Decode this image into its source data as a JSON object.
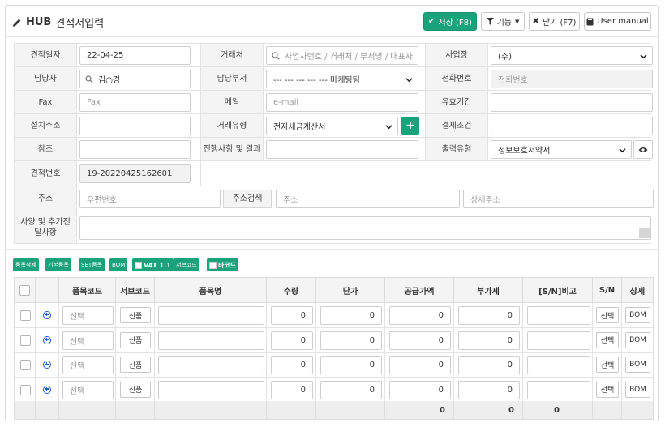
{
  "header": {
    "hub": "HUB",
    "title": "견적서입력",
    "save_label": "저장 (F8)",
    "func_label": "기능",
    "close_label": "닫기 (F7)",
    "manual_label": "User manual"
  },
  "form": {
    "quote_date_label": "견적일자",
    "quote_date_value": "22-04-25",
    "client_label": "거래처",
    "client_placeholder": "사업자번호 / 거래처 / 부서명 / 대표자",
    "biz_label": "사업장",
    "biz_value": "(주)",
    "manager_label": "담당자",
    "manager_value": "김○경",
    "dept_label": "담당부서",
    "dept_value": "--- --- --- --- --- 마케팅팀",
    "phone_label": "전화번호",
    "phone_placeholder": "전화번호",
    "fax_label": "Fax",
    "fax_placeholder": "Fax",
    "email_label": "메일",
    "email_placeholder": "e-mail",
    "valid_label": "유효기간",
    "install_label": "설치주소",
    "trade_type_label": "거래유형",
    "trade_type_value": "전자세금계산서",
    "payment_label": "결제조건",
    "ref_label": "참조",
    "progress_label": "진행사항 및 결과",
    "print_type_label": "출력유형",
    "print_type_value": "정보보호서약서",
    "quote_no_label": "견적번호",
    "quote_no_value": "19-20220425162601",
    "address_label": "주소",
    "zip_placeholder": "우편번호",
    "addr_search_label": "주소검색",
    "addr_placeholder": "주소",
    "addr_detail_placeholder": "상세주소",
    "notes_label": "사양 및 추가전달사항"
  },
  "toolbar": {
    "delete_item": "품목삭제",
    "basic_item": "기본품목",
    "set_item": "SET품목",
    "bom": "BOM",
    "vat": "VAT 1.1",
    "subcode": "서브코드",
    "barcode": "바코드"
  },
  "grid": {
    "headers": [
      "품목코드",
      "서브코드",
      "품목명",
      "수량",
      "단가",
      "공급가액",
      "부가세",
      "[S/N]비고",
      "S/N",
      "상세"
    ],
    "code_placeholder": "선택",
    "new_label": "신품",
    "select_label": "선택",
    "bom_label": "BOM",
    "rows": [
      {
        "qty": "0",
        "price": "0",
        "supply": "0",
        "vat": "0"
      },
      {
        "qty": "0",
        "price": "0",
        "supply": "0",
        "vat": "0"
      },
      {
        "qty": "0",
        "price": "0",
        "supply": "0",
        "vat": "0"
      },
      {
        "qty": "0",
        "price": "0",
        "supply": "0",
        "vat": "0"
      }
    ],
    "totals": {
      "supply": "0",
      "vat": "0",
      "note": "0"
    }
  },
  "colors": {
    "accent": "#1aa37a",
    "icon_blue": "#1e5bc6"
  }
}
